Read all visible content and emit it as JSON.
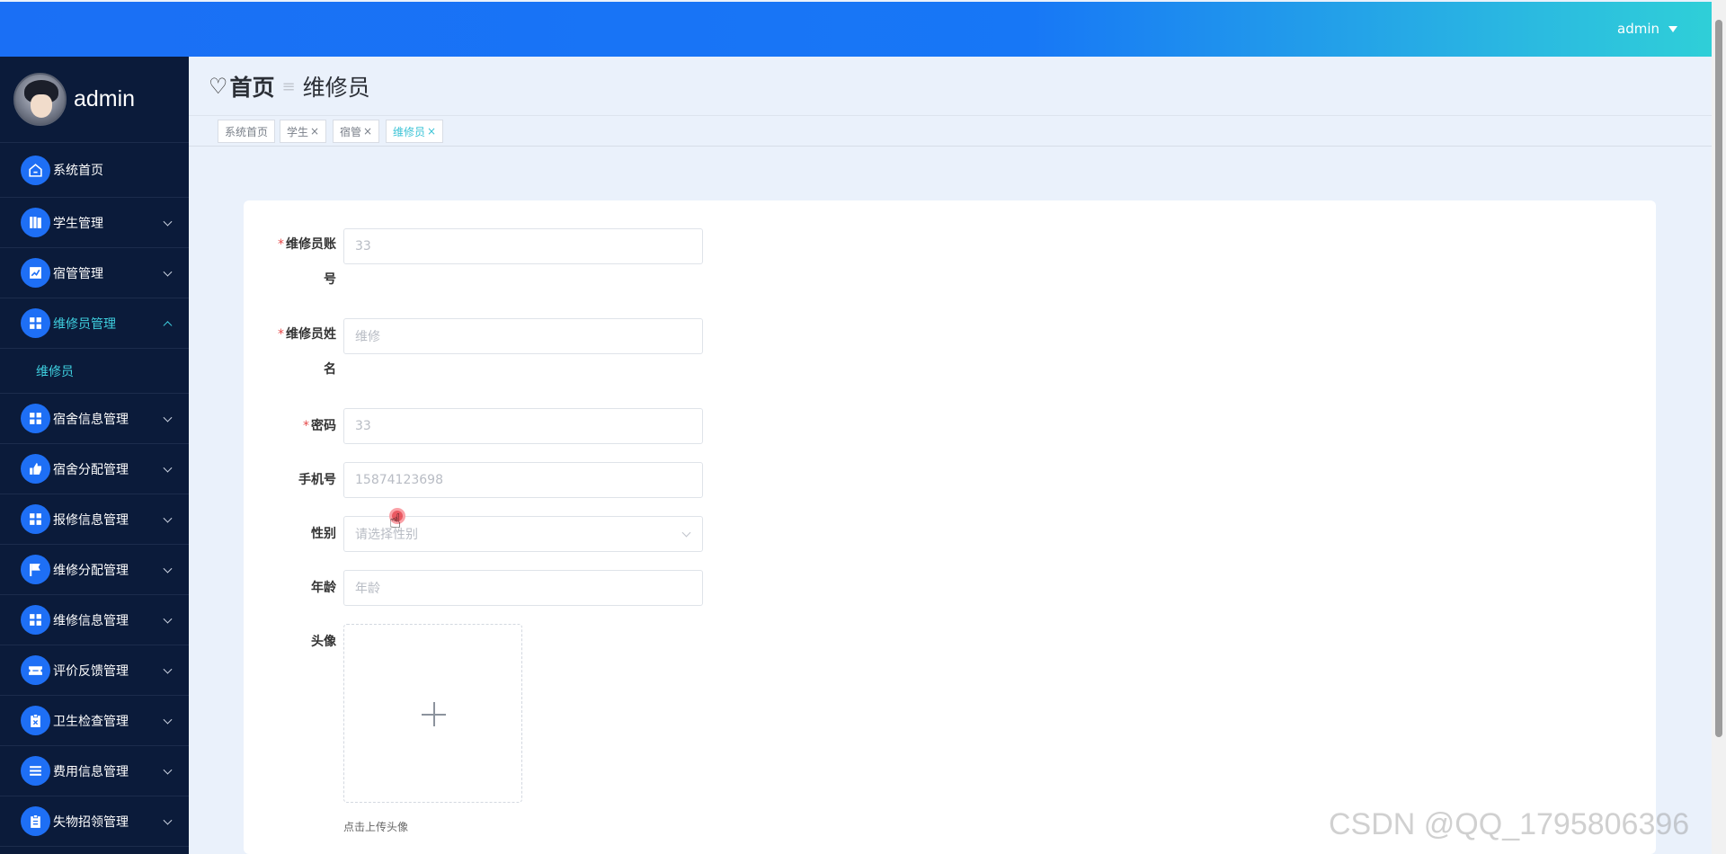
{
  "topbar": {
    "username": "admin"
  },
  "sidebar": {
    "profile_name": "admin",
    "items": [
      {
        "label": "系统首页",
        "icon": "home-icon",
        "expandable": false
      },
      {
        "label": "学生管理",
        "icon": "book-icon",
        "expandable": true
      },
      {
        "label": "宿管管理",
        "icon": "chart-icon",
        "expandable": true
      },
      {
        "label": "维修员管理",
        "icon": "grid-icon",
        "expandable": true,
        "expanded": true
      },
      {
        "label": "宿舍信息管理",
        "icon": "grid-icon",
        "expandable": true
      },
      {
        "label": "宿舍分配管理",
        "icon": "thumb-icon",
        "expandable": true
      },
      {
        "label": "报修信息管理",
        "icon": "grid-icon",
        "expandable": true
      },
      {
        "label": "维修分配管理",
        "icon": "flag-icon",
        "expandable": true
      },
      {
        "label": "维修信息管理",
        "icon": "grid-icon",
        "expandable": true
      },
      {
        "label": "评价反馈管理",
        "icon": "ticket-icon",
        "expandable": true
      },
      {
        "label": "卫生检查管理",
        "icon": "clipboard-icon",
        "expandable": true
      },
      {
        "label": "费用信息管理",
        "icon": "list-icon",
        "expandable": true
      },
      {
        "label": "失物招领管理",
        "icon": "clipboard-icon",
        "expandable": true
      }
    ],
    "submenu": {
      "label": "维修员"
    }
  },
  "breadcrumb": {
    "home": "首页",
    "separator": "≡",
    "current": "维修员"
  },
  "tags": [
    {
      "label": "系统首页",
      "closable": false,
      "active": false
    },
    {
      "label": "学生",
      "closable": true,
      "active": false
    },
    {
      "label": "宿管",
      "closable": true,
      "active": false
    },
    {
      "label": "维修员",
      "closable": true,
      "active": true
    }
  ],
  "form": {
    "account": {
      "label_line1": "维修员账",
      "label_line2": "号",
      "required": true,
      "value": "33"
    },
    "name": {
      "label_line1": "维修员姓",
      "label_line2": "名",
      "required": true,
      "value": "维修"
    },
    "password": {
      "label": "密码",
      "required": true,
      "value": "33"
    },
    "phone": {
      "label": "手机号",
      "value": "15874123698"
    },
    "gender": {
      "label": "性别",
      "placeholder": "请选择性别"
    },
    "age": {
      "label": "年龄",
      "placeholder": "年龄"
    },
    "avatar": {
      "label": "头像",
      "tip": "点击上传头像"
    }
  },
  "watermark": "CSDN @QQ_1795806396",
  "colors": {
    "topbar_start": "#1a6ff5",
    "topbar_end": "#2fcfd8",
    "sidebar_bg": "#0b1b3a",
    "accent": "#3fd0e0",
    "icon_bg": "#1e6ff5",
    "required": "#e64b4b"
  }
}
